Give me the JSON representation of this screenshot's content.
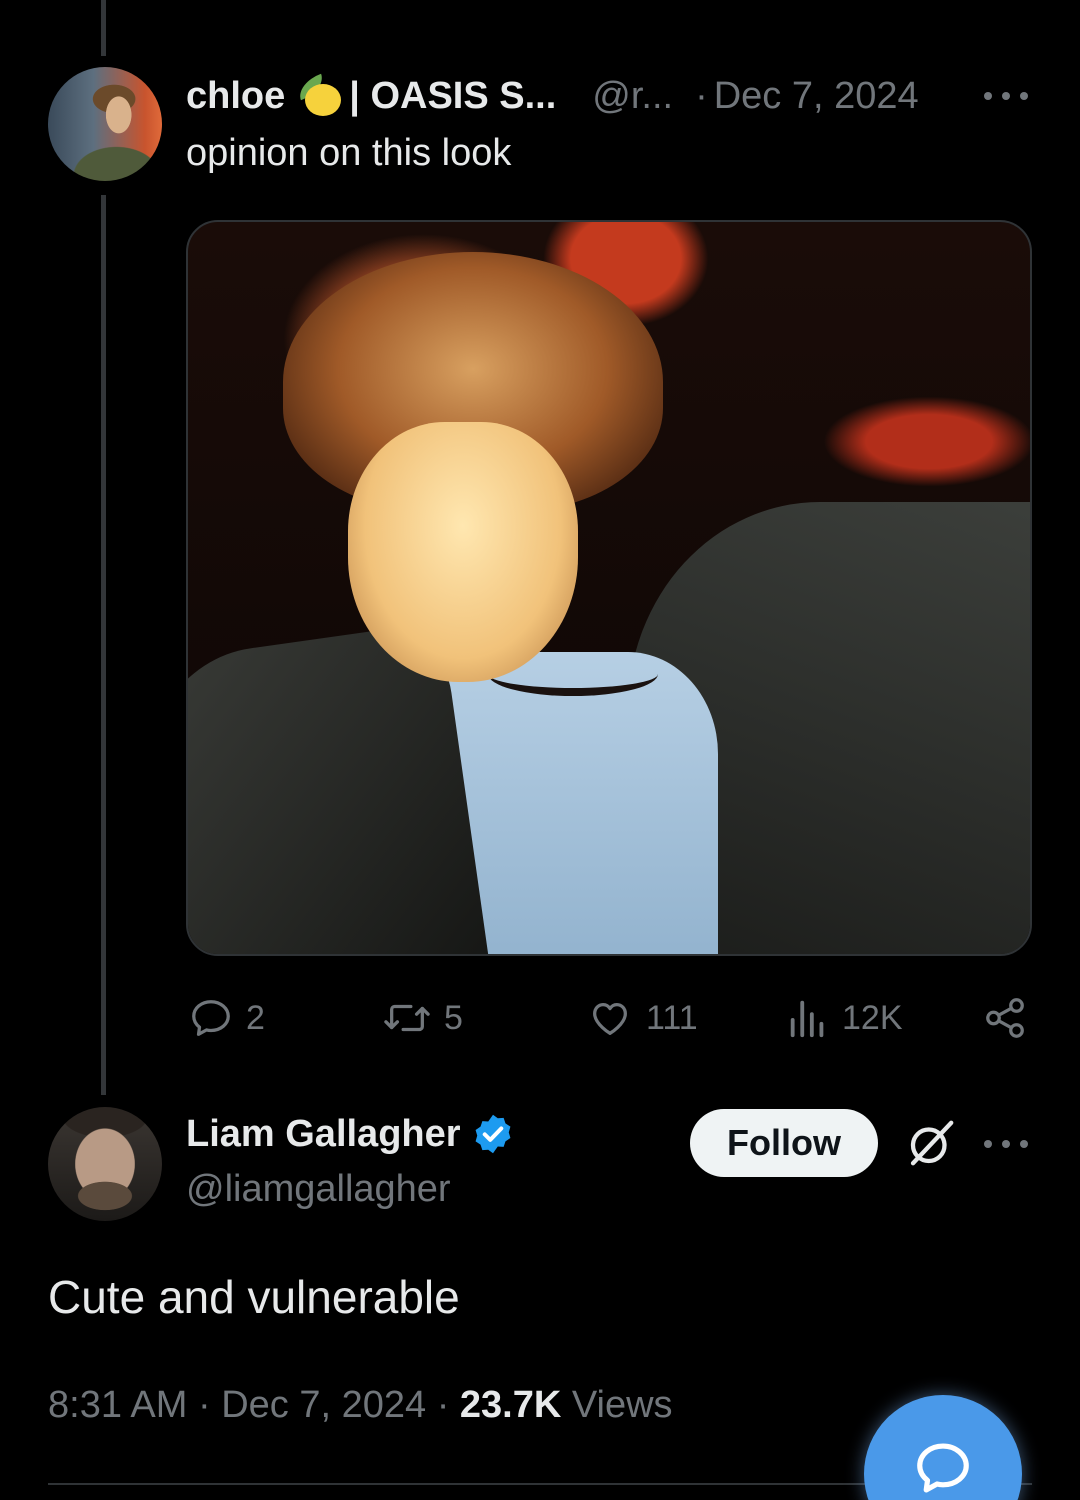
{
  "original_tweet": {
    "display_name": "chloe",
    "name_suffix": "| OASIS S...",
    "handle": "@r...",
    "date": "Dec 7, 2024",
    "text": "opinion on this look",
    "image_icon": "lemon-emoji",
    "stats": {
      "replies": "2",
      "reposts": "5",
      "likes": "111",
      "views": "12K"
    }
  },
  "reply_tweet": {
    "display_name": "Liam Gallagher",
    "handle": "@liamgallagher",
    "follow_label": "Follow",
    "text": "Cute and vulnerable",
    "time": "8:31 AM",
    "date": "Dec 7, 2024",
    "views_count": "23.7K",
    "views_label": "Views"
  },
  "colors": {
    "background": "#000000",
    "text_primary": "#e7e9ea",
    "text_secondary": "#71767b",
    "verified_blue": "#1d9bf0",
    "fab_blue": "#4a99e9"
  }
}
